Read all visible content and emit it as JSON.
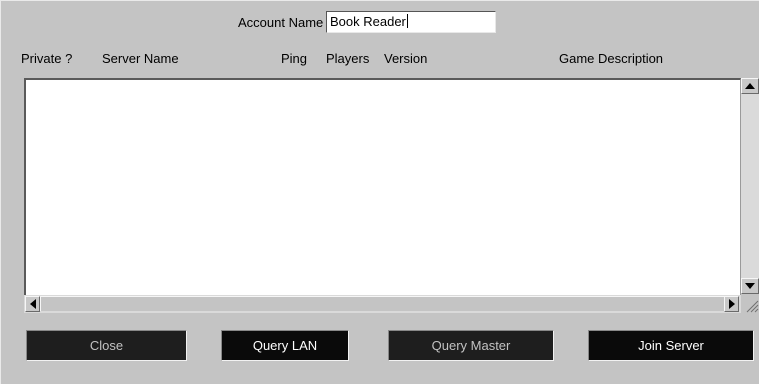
{
  "account": {
    "label": "Account Name",
    "value": "Book Reader"
  },
  "columns": [
    "Private ?",
    "Server Name",
    "Ping",
    "Players",
    "Version",
    "Game Description"
  ],
  "server_list": {
    "rows": []
  },
  "scrollbars": {
    "up": "up-arrow",
    "down": "down-arrow",
    "left": "left-arrow",
    "right": "right-arrow"
  },
  "buttons": {
    "close": "Close",
    "query_lan": "Query LAN",
    "query_master": "Query Master",
    "join_server": "Join Server"
  },
  "colors": {
    "window_bg": "#c4c4c4",
    "list_bg": "#ffffff",
    "button_bg": "#1e1e1e",
    "button_text": "#c2c2c2",
    "button_text_active": "#ffffff"
  }
}
